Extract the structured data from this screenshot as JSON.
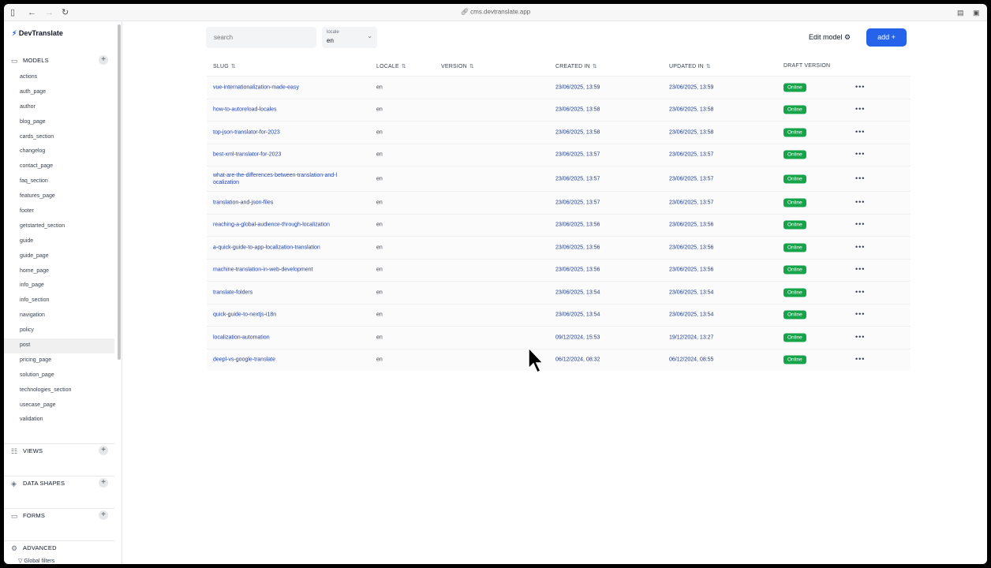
{
  "browser": {
    "url": "cms.devtranslate.app"
  },
  "brand": {
    "name": "DevTranslate"
  },
  "sidebar": {
    "sections": {
      "models": "MODELS",
      "views": "VIEWS",
      "data_shapes": "DATA SHAPES",
      "forms": "FORMS",
      "advanced": "ADVANCED"
    },
    "models": [
      "actions",
      "auth_page",
      "author",
      "blog_page",
      "cards_section",
      "changelog",
      "contact_page",
      "faq_section",
      "features_page",
      "footer",
      "getstarted_section",
      "guide",
      "guide_page",
      "home_page",
      "info_page",
      "info_section",
      "navigation",
      "policy",
      "post",
      "pricing_page",
      "solution_page",
      "technologies_section",
      "usecase_page",
      "validation"
    ],
    "active_model": "post",
    "advanced_items": [
      "Global filters"
    ]
  },
  "toolbar": {
    "search_placeholder": "search",
    "locale_label": "locale",
    "locale_value": "en",
    "edit_model_label": "Edit model",
    "add_label": "add"
  },
  "table": {
    "headers": [
      "SLUG",
      "LOCALE",
      "VERSION",
      "CREATED IN",
      "UPDATED IN",
      "DRAFT VERSION"
    ],
    "rows": [
      {
        "slug": "vue-internationalization-made-easy",
        "locale": "en",
        "created": "23/06/2025, 13:59",
        "updated": "23/06/2025, 13:59",
        "status": "Online"
      },
      {
        "slug": "how-to-autoreload-locales",
        "locale": "en",
        "created": "23/06/2025, 13:58",
        "updated": "23/06/2025, 13:58",
        "status": "Online"
      },
      {
        "slug": "top-json-translator-for-2023",
        "locale": "en",
        "created": "23/06/2025, 13:58",
        "updated": "23/06/2025, 13:58",
        "status": "Online"
      },
      {
        "slug": "best-xml-translator-for-2023",
        "locale": "en",
        "created": "23/06/2025, 13:57",
        "updated": "23/06/2025, 13:57",
        "status": "Online"
      },
      {
        "slug": "what-are-the-differences-between-translation-and-l ocalization",
        "locale": "en",
        "created": "23/06/2025, 13:57",
        "updated": "23/06/2025, 13:57",
        "status": "Online"
      },
      {
        "slug": "translation-and-json-files",
        "locale": "en",
        "created": "23/06/2025, 13:57",
        "updated": "23/06/2025, 13:57",
        "status": "Online"
      },
      {
        "slug": "reaching-a-global-audience-through-localization",
        "locale": "en",
        "created": "23/06/2025, 13:56",
        "updated": "23/06/2025, 13:56",
        "status": "Online"
      },
      {
        "slug": "a-quick-guide-to-app-localization-translation",
        "locale": "en",
        "created": "23/06/2025, 13:56",
        "updated": "23/06/2025, 13:56",
        "status": "Online"
      },
      {
        "slug": "machine-translation-in-web-development",
        "locale": "en",
        "created": "23/06/2025, 13:56",
        "updated": "23/06/2025, 13:56",
        "status": "Online"
      },
      {
        "slug": "translate-folders",
        "locale": "en",
        "created": "23/06/2025, 13:54",
        "updated": "23/06/2025, 13:54",
        "status": "Online"
      },
      {
        "slug": "quick-guide-to-nextjs-i18n",
        "locale": "en",
        "created": "23/06/2025, 13:54",
        "updated": "23/06/2025, 13:54",
        "status": "Online"
      },
      {
        "slug": "localization-automation",
        "locale": "en",
        "created": "09/12/2024, 15:53",
        "updated": "19/12/2024, 13:27",
        "status": "Online"
      },
      {
        "slug": "deepl-vs-google-translate",
        "locale": "en",
        "created": "06/12/2024, 08:32",
        "updated": "06/12/2024, 08:55",
        "status": "Online"
      }
    ]
  },
  "icons": {
    "sidebar_toggle": "sidebar-toggle-icon",
    "back": "arrow-left-icon",
    "forward": "arrow-right-icon",
    "reload": "reload-icon",
    "link": "link-icon",
    "gear": "gear-icon",
    "plus": "plus-icon",
    "sort": "sort-icon",
    "more": "more-icon",
    "cursor": "mouse-cursor-icon"
  },
  "colors": {
    "accent": "#2563eb",
    "online": "#16a34a"
  }
}
